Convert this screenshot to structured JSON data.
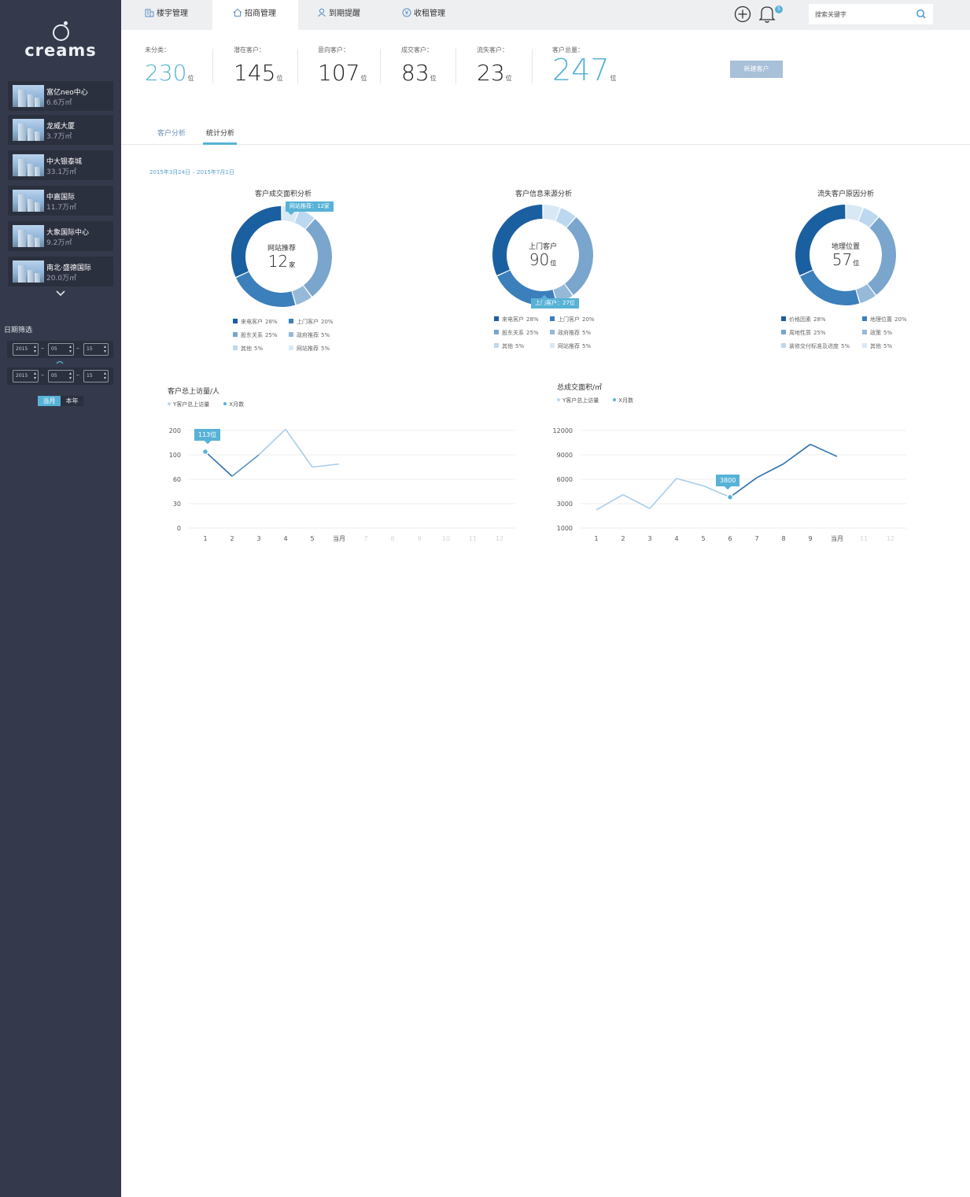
{
  "app": {
    "logo_text": "creams"
  },
  "sidebar": {
    "buildings": [
      {
        "name": "富亿neo中心",
        "area": "6.6万㎡"
      },
      {
        "name": "龙威大厦",
        "area": "3.7万㎡"
      },
      {
        "name": "中大银泰城",
        "area": "33.1万㎡"
      },
      {
        "name": "中嘉国际",
        "area": "11.7万㎡"
      },
      {
        "name": "大象国际中心",
        "area": "9.2万㎡"
      },
      {
        "name": "南北·盛德国际",
        "area": "20.0万㎡"
      }
    ],
    "date_filter_label": "日期筛选",
    "date_from": {
      "year": "2015",
      "month": "05",
      "day": "15"
    },
    "date_to": {
      "year": "2015",
      "month": "05",
      "day": "15"
    },
    "period_month": "当月",
    "period_year": "本年"
  },
  "nav": {
    "tabs": [
      {
        "label": "楼宇管理",
        "icon": "building-icon"
      },
      {
        "label": "招商管理",
        "icon": "home-icon"
      },
      {
        "label": "到期提醒",
        "icon": "user-icon"
      },
      {
        "label": "收租管理",
        "icon": "yen-icon"
      }
    ],
    "active_tab": 1,
    "notification_count": "5",
    "search_placeholder": "搜索关键字"
  },
  "stats": [
    {
      "label": "未分类：",
      "value": "230",
      "unit": "位"
    },
    {
      "label": "潜在客户：",
      "value": "145",
      "unit": "位"
    },
    {
      "label": "意向客户：",
      "value": "107",
      "unit": "位"
    },
    {
      "label": "成交客户：",
      "value": "83",
      "unit": "位"
    },
    {
      "label": "流失客户：",
      "value": "23",
      "unit": "位"
    },
    {
      "label": "客户总量：",
      "value": "247",
      "unit": "位"
    }
  ],
  "new_customer_button": "新建客户",
  "subtabs": {
    "customer_analysis": "客户分析",
    "stats_analysis": "统计分析"
  },
  "date_range": "2015年3月24日 – 2015年7月1日",
  "colors": {
    "accent": "#57b2d6",
    "donut": [
      "#1a5fa0",
      "#3b7fbb",
      "#96b9d9",
      "#7aa5cc",
      "#bcd8f0",
      "#d9e8f5"
    ]
  },
  "donuts": [
    {
      "title": "客户成交面积分析",
      "center_label": "网站推荐",
      "center_value": "12",
      "center_unit": "家",
      "tooltip": "网站推荐：12家",
      "legend": [
        {
          "name": "来电客户",
          "pct": "28%"
        },
        {
          "name": "上门客户",
          "pct": "20%"
        },
        {
          "name": "股东关系",
          "pct": "25%"
        },
        {
          "name": "政府推荐",
          "pct": "5%"
        },
        {
          "name": "其他",
          "pct": "5%"
        },
        {
          "name": "网站推荐",
          "pct": "5%"
        }
      ]
    },
    {
      "title": "客户信息来源分析",
      "center_label": "上门客户",
      "center_value": "90",
      "center_unit": "位",
      "tooltip": "上门客户：27位",
      "legend": [
        {
          "name": "来电客户",
          "pct": "28%"
        },
        {
          "name": "上门客户",
          "pct": "20%"
        },
        {
          "name": "股东关系",
          "pct": "25%"
        },
        {
          "name": "政府推荐",
          "pct": "5%"
        },
        {
          "name": "其他",
          "pct": "5%"
        },
        {
          "name": "网站推荐",
          "pct": "5%"
        }
      ]
    },
    {
      "title": "流失客户原因分析",
      "center_label": "地理位置",
      "center_value": "57",
      "center_unit": "位",
      "tooltip": "",
      "legend": [
        {
          "name": "价格因素",
          "pct": "28%"
        },
        {
          "name": "地理位置",
          "pct": "20%"
        },
        {
          "name": "周地性质",
          "pct": "25%"
        },
        {
          "name": "政策",
          "pct": "5%"
        },
        {
          "name": "装修交付标准及进度",
          "pct": "5%"
        },
        {
          "name": "其他",
          "pct": "5%"
        }
      ]
    }
  ],
  "chart_data": [
    {
      "type": "line",
      "title": "客户总上访量/人",
      "legend": [
        "Y客户总上访量",
        "X月数"
      ],
      "y_ticks": [
        "200",
        "100",
        "60",
        "30",
        "0"
      ],
      "categories": [
        "1",
        "2",
        "3",
        "4",
        "5",
        "当月",
        "7",
        "8",
        "9",
        "10",
        "11",
        "12"
      ],
      "series": [
        {
          "values": [
            113,
            65,
            100,
            205,
            80,
            85
          ]
        }
      ],
      "highlight": {
        "index": 0,
        "label": "113位"
      }
    },
    {
      "type": "line",
      "title": "总成交面积/㎡",
      "legend": [
        "Y客户总上访量",
        "X月数"
      ],
      "y_ticks": [
        "12000",
        "9000",
        "6000",
        "3000",
        "1000"
      ],
      "categories": [
        "1",
        "2",
        "3",
        "4",
        "5",
        "6",
        "7",
        "8",
        "9",
        "当月",
        "11",
        "12"
      ],
      "series": [
        {
          "values": [
            2500,
            4100,
            2600,
            6100,
            5200,
            3800,
            6200,
            7900,
            10300,
            8800
          ]
        }
      ],
      "highlight": {
        "index": 5,
        "label": "3800"
      }
    }
  ]
}
